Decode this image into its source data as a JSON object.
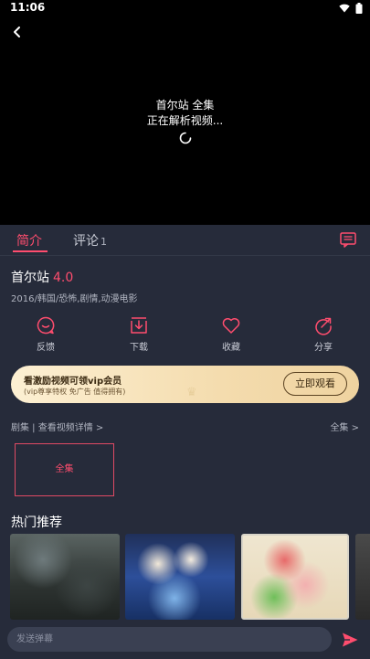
{
  "status_bar": {
    "time": "11:06"
  },
  "player": {
    "title": "首尔站 全集",
    "status": "正在解析视频..."
  },
  "tabs": [
    {
      "label": "简介",
      "active": true
    },
    {
      "label": "评论",
      "count": "1"
    }
  ],
  "video": {
    "title": "首尔站",
    "score": "4.0",
    "meta": "2016/韩国/恐怖,剧情,动漫电影"
  },
  "actions": [
    {
      "label": "反馈",
      "icon": "feedback-icon"
    },
    {
      "label": "下载",
      "icon": "download-icon"
    },
    {
      "label": "收藏",
      "icon": "heart-icon"
    },
    {
      "label": "分享",
      "icon": "share-icon"
    }
  ],
  "vip_banner": {
    "headline": "看激励视频可领vip会员",
    "subline": "(vip尊享特权 免广告 值得拥有)",
    "button": "立即观看"
  },
  "episodes": {
    "header": "剧集 | 查看视频详情 >",
    "all_link": "全集 >",
    "items": [
      "全集"
    ]
  },
  "hot": {
    "title": "热门推荐"
  },
  "danmaku": {
    "placeholder": "发送弹幕"
  },
  "colors": {
    "accent": "#ff4d6e",
    "background": "#262b3a",
    "player": "#000000",
    "vip_gold": "#f4dcae"
  }
}
